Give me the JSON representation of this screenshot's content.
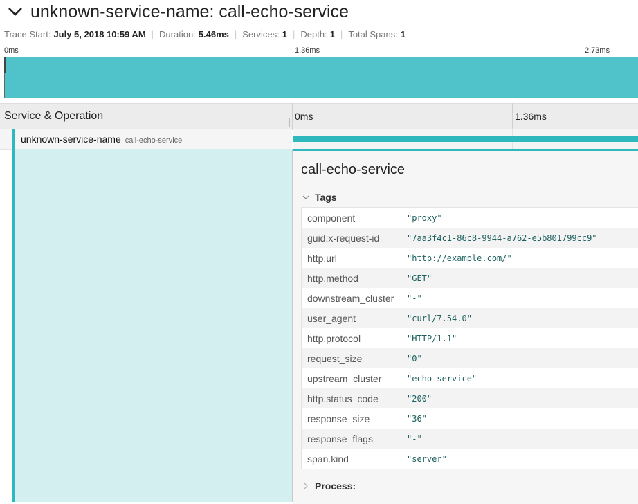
{
  "header": {
    "title": "unknown-service-name: call-echo-service",
    "collapse_icon": "chevron-down-icon"
  },
  "meta": [
    {
      "label": "Trace Start:",
      "value": "July 5, 2018 10:59 AM"
    },
    {
      "label": "Duration:",
      "value": "5.46ms"
    },
    {
      "label": "Services:",
      "value": "1"
    },
    {
      "label": "Depth:",
      "value": "1"
    },
    {
      "label": "Total Spans:",
      "value": "1"
    }
  ],
  "minimap": {
    "ticks": [
      "0ms",
      "1.36ms",
      "2.73ms"
    ]
  },
  "timeline": {
    "column_label": "Service & Operation",
    "ticks": [
      "0ms",
      "1.36ms"
    ]
  },
  "span": {
    "service": "unknown-service-name",
    "operation": "call-echo-service"
  },
  "detail": {
    "title": "call-echo-service",
    "tags_label": "Tags",
    "process_label": "Process:",
    "tags": [
      {
        "key": "component",
        "value": "\"proxy\""
      },
      {
        "key": "guid:x-request-id",
        "value": "\"7aa3f4c1-86c8-9944-a762-e5b801799cc9\""
      },
      {
        "key": "http.url",
        "value": "\"http://example.com/\""
      },
      {
        "key": "http.method",
        "value": "\"GET\""
      },
      {
        "key": "downstream_cluster",
        "value": "\"-\""
      },
      {
        "key": "user_agent",
        "value": "\"curl/7.54.0\""
      },
      {
        "key": "http.protocol",
        "value": "\"HTTP/1.1\""
      },
      {
        "key": "request_size",
        "value": "\"0\""
      },
      {
        "key": "upstream_cluster",
        "value": "\"echo-service\""
      },
      {
        "key": "http.status_code",
        "value": "\"200\""
      },
      {
        "key": "response_size",
        "value": "\"36\""
      },
      {
        "key": "response_flags",
        "value": "\"-\""
      },
      {
        "key": "span.kind",
        "value": "\"server\""
      }
    ]
  },
  "colors": {
    "accent": "#2fb8bd",
    "minimap_fill": "#4fc3c9",
    "left_fill": "#d3eff0"
  }
}
